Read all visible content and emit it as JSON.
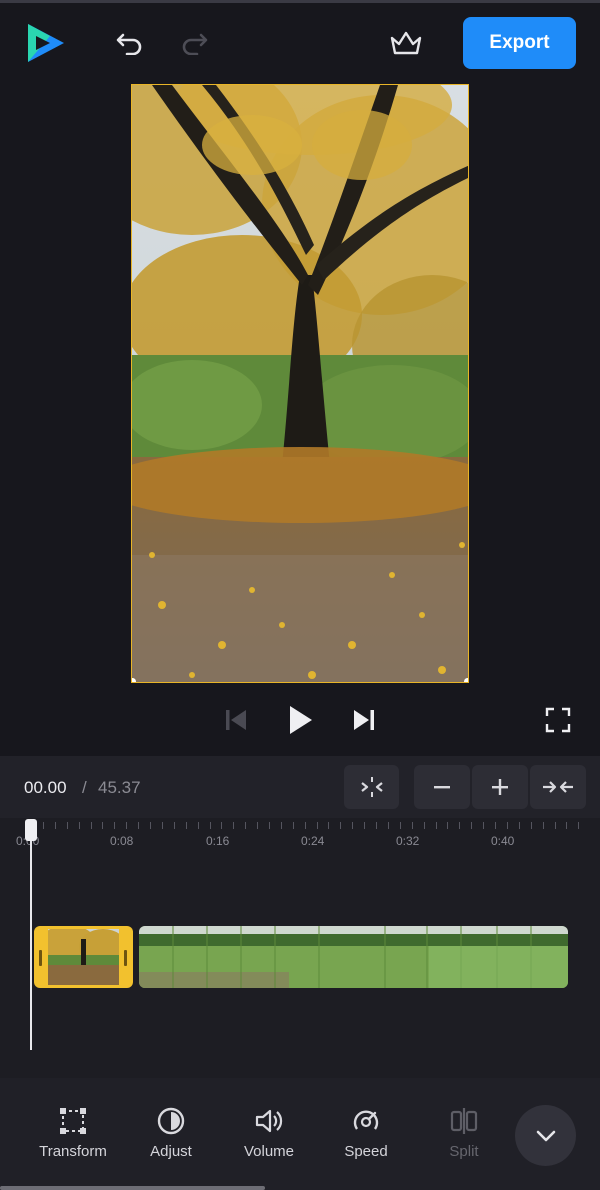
{
  "app": {
    "logo_icon": "play-logo-icon",
    "brand_colors": [
      "#2ad6b0",
      "#1f8cf9"
    ]
  },
  "header": {
    "undo_icon": "undo-icon",
    "redo_icon": "redo-icon",
    "premium_icon": "crown-icon",
    "export_label": "Export",
    "export_color": "#1f8cf9"
  },
  "preview": {
    "content": "video-frame-autumn-tree",
    "selection_color": "#e9b527"
  },
  "playback": {
    "skip_back_icon": "skip-back-icon",
    "play_icon": "play-icon",
    "skip_forward_icon": "skip-forward-icon",
    "fullscreen_icon": "fullscreen-icon"
  },
  "time": {
    "current": "00.00",
    "separator": "/",
    "total": "45.37"
  },
  "timeline_tools": {
    "snap_icon": "split-align-icon",
    "zoom_out_icon": "minus-icon",
    "zoom_in_icon": "plus-icon",
    "fit_icon": "fit-icon"
  },
  "ruler": {
    "labels": [
      "0:00",
      "0:08",
      "0:16",
      "0:24",
      "0:32",
      "0:40"
    ]
  },
  "tracks": {
    "clips": [
      {
        "name": "autumn-tree-clip",
        "selected": true,
        "accent": "#f2c12e"
      },
      {
        "name": "park-grass-clip",
        "selected": false
      }
    ]
  },
  "toolbar": {
    "tools": [
      {
        "label": "Transform",
        "icon": "transform-icon",
        "enabled": true
      },
      {
        "label": "Adjust",
        "icon": "adjust-icon",
        "enabled": true
      },
      {
        "label": "Volume",
        "icon": "volume-icon",
        "enabled": true
      },
      {
        "label": "Speed",
        "icon": "speed-icon",
        "enabled": true
      },
      {
        "label": "Split",
        "icon": "split-icon",
        "enabled": false
      }
    ],
    "collapse_icon": "chevron-down-icon"
  }
}
